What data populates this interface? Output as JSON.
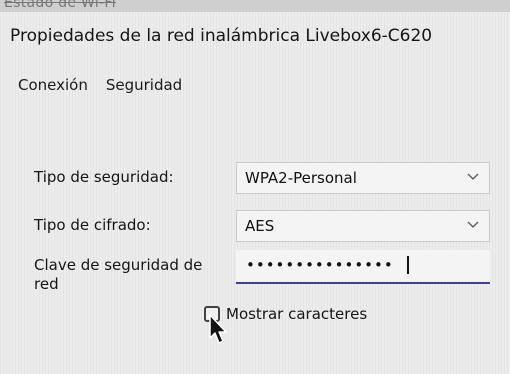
{
  "background_window": {
    "title": "Estado de Wi-Fi"
  },
  "dialog": {
    "title": "Propiedades de la red inalámbrica Livebox6-C620",
    "tabs": [
      {
        "label": "Conexión",
        "active": false
      },
      {
        "label": "Seguridad",
        "active": true
      }
    ],
    "security": {
      "type_label": "Tipo de seguridad:",
      "type_value": "WPA2-Personal",
      "cipher_label": "Tipo de cifrado:",
      "cipher_value": "AES",
      "key_label": "Clave de seguridad de red",
      "key_masked": "•••••••••••••••",
      "show_chars_label": "Mostrar caracteres",
      "show_chars_checked": false
    }
  },
  "colors": {
    "input_underline": "#3d3fa0",
    "dialog_bg": "#ececec"
  },
  "icons": [
    "chevron-down-icon",
    "mouse-cursor-icon"
  ]
}
